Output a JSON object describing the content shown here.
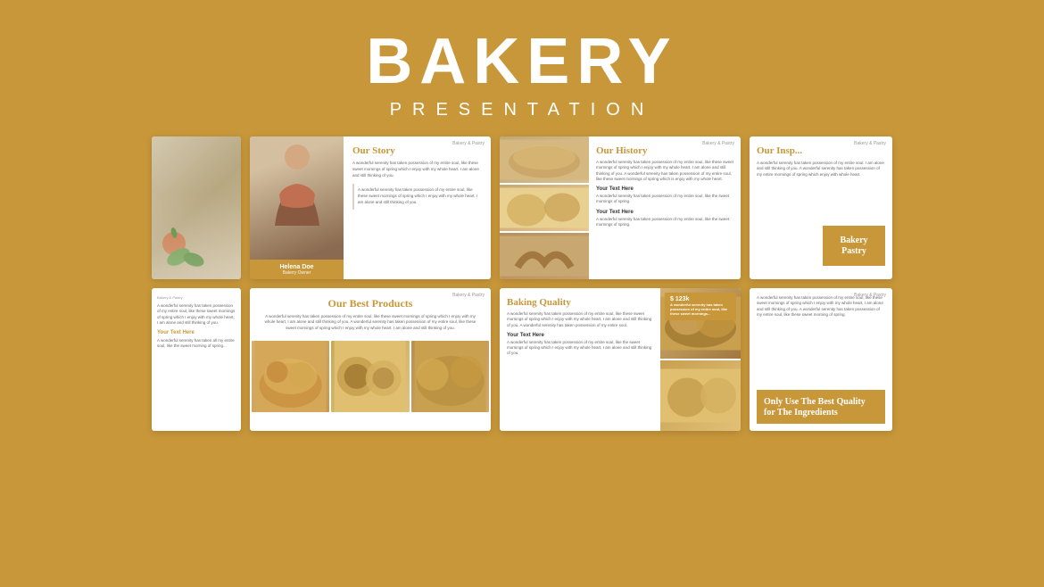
{
  "header": {
    "title": "BAKERY",
    "subtitle": "PRESENTATION"
  },
  "slides": {
    "row1": [
      {
        "id": "partial-left-1",
        "type": "partial-image"
      },
      {
        "id": "our-story",
        "label": "Bakery & Pastry",
        "title": "Our Story",
        "body_text": "A wonderful serenity has taken possession of my entire soul, like these sweet mornings of spring which I enjoy with my whole heart. I am alone and still thinking of you.",
        "inner_text": "A wonderful serenity has taken possession of my entire soul, like these sweet mornings of spring which I enjoy with my whole heart. I am alone and still thinking of you.",
        "person_name": "Helena Doe",
        "person_role": "Bakery Owner"
      },
      {
        "id": "our-history",
        "label": "Bakery & Pastry",
        "title": "Our History",
        "body_text": "A wonderful serenity has taken possession of my entire soul, like these sweet mornings of spring which I enjoy with my whole heart. I am alone and still thinking of you. A wonderful serenity has taken possession of my entire soul, like these sweet mornings of spring which is enjoy with my whole heart.",
        "text_heading_1": "Your Text Here",
        "text_body_1": "A wonderful serenity has taken possession of my entire soul, like the sweet mornings of spring.",
        "text_heading_2": "Your Text Here",
        "text_body_2": "A wonderful serenity has taken possession of my entire soul, like the sweet mornings of spring."
      },
      {
        "id": "our-inspiration",
        "label": "Bakery & Pastry",
        "title": "Our Insp...",
        "body_text": "A wonderful serenity has taken possession of my entire soul. I am alone and still thinking of you. A wonderful serenity has taken possession of my entire mornings of spring which enjoy with whole heart.",
        "badge_line1": "Bakery",
        "badge_line2": "Pastry"
      }
    ],
    "row2": [
      {
        "id": "partial-left-2",
        "label": "Bakery & Pastry",
        "text_1": "A wonderful serenity has taken possession of my entire soul, like these sweet mornings of spring which I enjoy with my whole heart, I am alone and still thinking of you.",
        "text_heading": "Your Text Here",
        "text_2": "A wonderful serenity has taken all my entire soul, like the sweet morning of spring..."
      },
      {
        "id": "our-best-products",
        "label": "Bakery & Pastry",
        "title": "Our Best Products",
        "description": "A wonderful serenity has taken possession of my entire soul, like these sweet mornings of spring which I enjoy with my whole heart, I am alone and still thinking of you. A wonderful serenity has taken possession of my entire soul, like these sweet mornings of spring which I enjoy with my whole heart. I am alone and still thinking of you."
      },
      {
        "id": "baking-quality",
        "label": "Bakery & Pastry",
        "title": "Baking Quality",
        "body_text": "A wonderful serenity has taken possession of my entire soul, like these sweet mornings of spring which I enjoy with my whole heart, I am alone and still thinking of you. A wonderful serenity has taken possession of my entire soul.",
        "text_heading": "Your Text Here",
        "text_body": "A wonderful serenity has taken possession of my entire soul, like the sweet mornings of spring which I enjoy with my whole heart, I am alone and still thinking of you.",
        "price_badge": "$ 123k",
        "price_subtext": "A wonderful serenity has taken possession of my entire soul, like these sweet mornings..."
      },
      {
        "id": "partial-right-2",
        "label": "Bakery & Pastry",
        "body_text": "A wonderful serenity has taken possession of my entire soul, like these sweet mornings of spring which I enjoy with my whole heart, I am alone and still thinking of you. A wonderful serenity has taken possession of my entire soul, like these sweet morning of spring.",
        "badge_text": "Only Use The Best Quality for The Ingredients"
      }
    ]
  }
}
